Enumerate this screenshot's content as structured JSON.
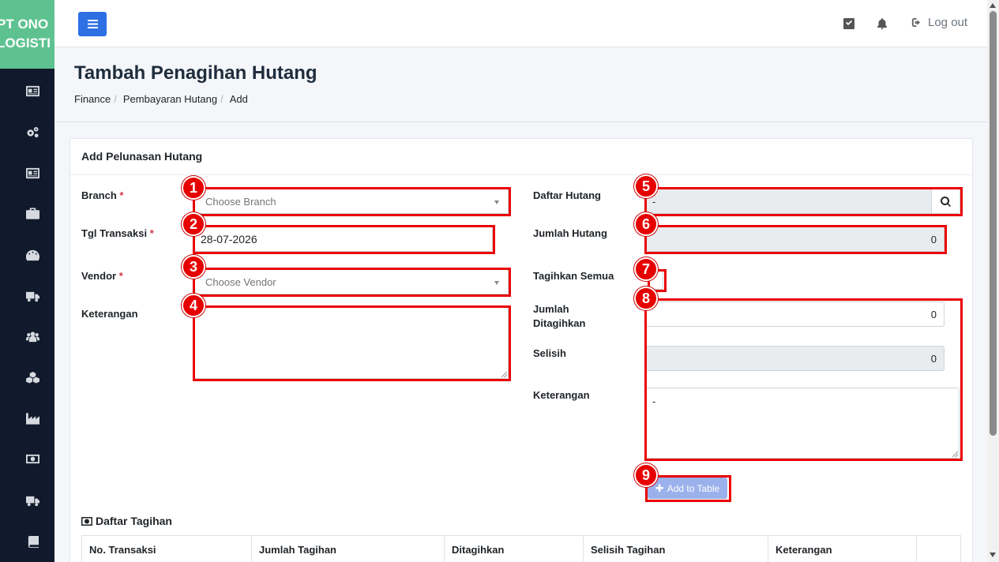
{
  "brand": {
    "line1": "PT ONO",
    "line2": "LOGISTI"
  },
  "sidebar": {
    "icons": [
      "id-card-icon",
      "cogs-icon",
      "id-card-icon",
      "briefcase-icon",
      "tachometer-icon",
      "truck-icon",
      "users-icon",
      "cubes-icon",
      "industry-icon",
      "money-icon",
      "truck-icon",
      "book-icon"
    ]
  },
  "topbar": {
    "logout_label": "Log out"
  },
  "page": {
    "title": "Tambah Penagihan Hutang",
    "breadcrumb": [
      "Finance",
      "Pembayaran Hutang",
      "Add"
    ]
  },
  "card": {
    "title": "Add Pelunasan Hutang"
  },
  "form_left": {
    "branch_label": "Branch",
    "branch_placeholder": "Choose Branch",
    "tgl_label": "Tgl Transaksi",
    "tgl_value": "28-07-2026",
    "vendor_label": "Vendor",
    "vendor_placeholder": "Choose Vendor",
    "keterangan_label": "Keterangan",
    "required_mark": "*"
  },
  "form_right": {
    "daftar_hutang_label": "Daftar Hutang",
    "daftar_hutang_value": "-",
    "jumlah_hutang_label": "Jumlah Hutang",
    "jumlah_hutang_value": "0",
    "tagihkan_semua_label": "Tagihkan Semua",
    "jumlah_ditagihkan_label_1": "Jumlah",
    "jumlah_ditagihkan_label_2": "Ditagihkan",
    "jumlah_ditagihkan_value": "0",
    "selisih_label": "Selisih",
    "selisih_value": "0",
    "keterangan_label": "Keterangan",
    "keterangan_value": "-",
    "add_button": "Add to Table"
  },
  "annotations": [
    "1",
    "2",
    "3",
    "4",
    "5",
    "6",
    "7",
    "8",
    "9"
  ],
  "table": {
    "title": "Daftar Tagihan",
    "columns": [
      "No. Transaksi",
      "Jumlah Tagihan",
      "Ditagihkan",
      "Selisih Tagihan",
      "Keterangan",
      ""
    ]
  }
}
